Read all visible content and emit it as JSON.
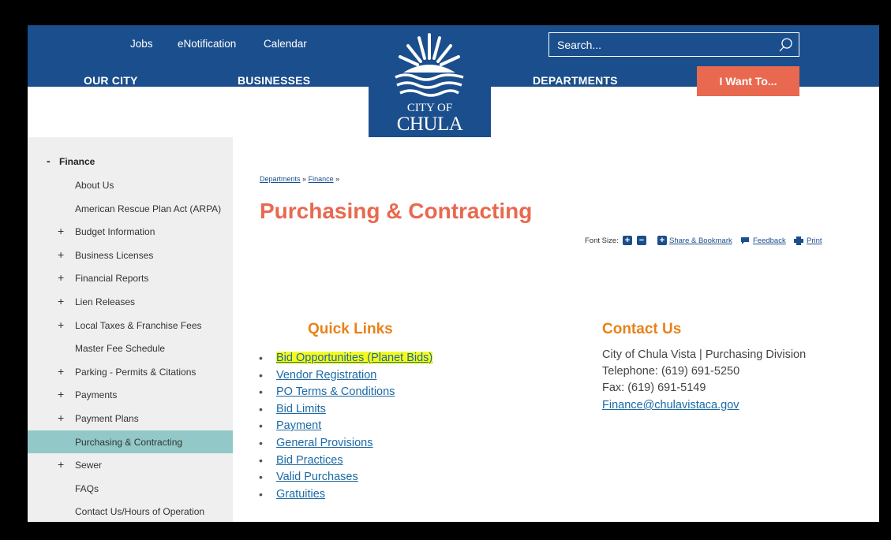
{
  "header": {
    "util_links": [
      "Jobs",
      "eNotification",
      "Calendar"
    ],
    "nav": [
      "OUR CITY",
      "BUSINESSES",
      "DEPARTMENTS"
    ],
    "search_placeholder": "Search...",
    "i_want_to": "I Want To...",
    "logo_line1": "CITY OF",
    "logo_line2": "CHULA VISTA",
    "brand_color": "#1b4e8c",
    "accent_color": "#e8694f"
  },
  "sidebar": {
    "heading": "Finance",
    "heading_toggle": "-",
    "items": [
      {
        "label": "About Us",
        "expandable": false
      },
      {
        "label": "American Rescue Plan Act (ARPA)",
        "expandable": false
      },
      {
        "label": "Budget Information",
        "expandable": true
      },
      {
        "label": "Business Licenses",
        "expandable": true
      },
      {
        "label": "Financial Reports",
        "expandable": true
      },
      {
        "label": "Lien Releases",
        "expandable": true
      },
      {
        "label": "Local Taxes & Franchise Fees",
        "expandable": true
      },
      {
        "label": "Master Fee Schedule",
        "expandable": false
      },
      {
        "label": "Parking - Permits & Citations",
        "expandable": true
      },
      {
        "label": "Payments",
        "expandable": true
      },
      {
        "label": "Payment Plans",
        "expandable": true
      },
      {
        "label": "Purchasing & Contracting",
        "expandable": false,
        "active": true
      },
      {
        "label": "Sewer",
        "expandable": true
      },
      {
        "label": "FAQs",
        "expandable": false
      },
      {
        "label": "Contact Us/Hours of Operation",
        "expandable": false
      }
    ]
  },
  "breadcrumb": {
    "items": [
      "Departments",
      "Finance"
    ],
    "separator": "»"
  },
  "page_title": "Purchasing & Contracting",
  "tools": {
    "font_size_label": "Font Size:",
    "share": "Share & Bookmark",
    "feedback": "Feedback",
    "print": "Print"
  },
  "quick_links": {
    "heading": "Quick Links",
    "items": [
      "Bid Opportunities (Planet Bids)",
      "Vendor Registration",
      "PO Terms & Conditions",
      "Bid Limits",
      "Payment",
      "General Provisions",
      "Bid Practices",
      "Valid Purchases",
      "Gratuities"
    ]
  },
  "contact": {
    "heading": "Contact Us",
    "lines": [
      "City of Chula Vista | Purchasing Division",
      "Telephone: (619) 691-5250",
      "Fax: (619) 691-5149"
    ],
    "email": "Finance@chulavistaca.gov"
  }
}
